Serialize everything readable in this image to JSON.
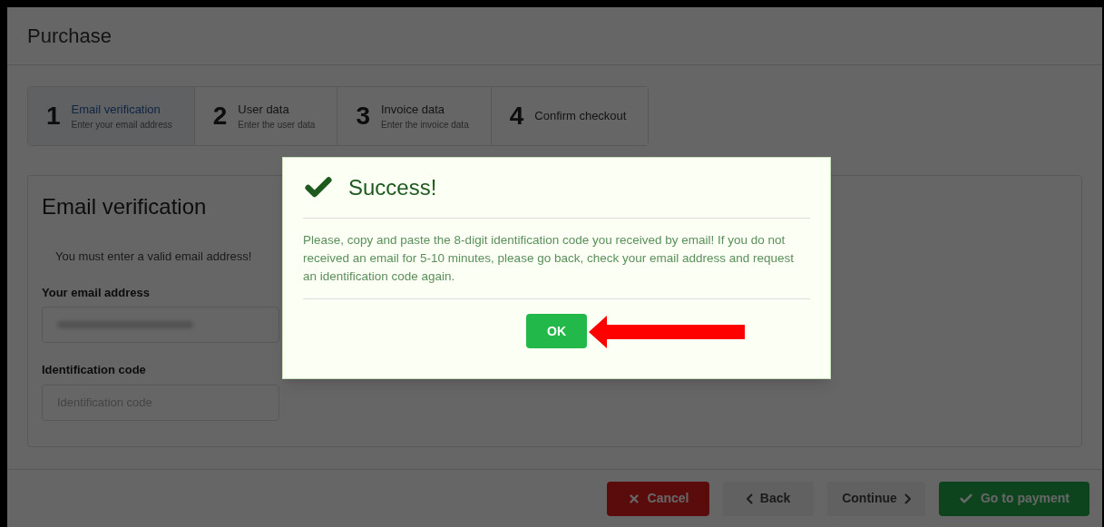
{
  "page": {
    "title": "Purchase"
  },
  "steps": [
    {
      "number": "1",
      "title": "Email verification",
      "subtitle": "Enter your email address",
      "selected": true
    },
    {
      "number": "2",
      "title": "User data",
      "subtitle": "Enter the user data",
      "selected": false
    },
    {
      "number": "3",
      "title": "Invoice data",
      "subtitle": "Enter the invoice data",
      "selected": false
    },
    {
      "number": "4",
      "title": "Confirm checkout",
      "selected": false
    }
  ],
  "form": {
    "heading": "Email verification",
    "notice": "You must enter a valid email address!",
    "fields": [
      {
        "label": "Your email address",
        "kind": "blurred"
      },
      {
        "label": "Identification code",
        "kind": "input",
        "placeholder": "Identification code"
      }
    ]
  },
  "footer_buttons": [
    {
      "label": "Cancel",
      "kind": "cancel",
      "disabled": false
    },
    {
      "label": "Back",
      "kind": "back",
      "disabled": true
    },
    {
      "label": "Continue",
      "kind": "continue",
      "disabled": true
    },
    {
      "label": "Go to payment",
      "kind": "pay",
      "disabled": false
    }
  ],
  "dialog": {
    "title": "Success!",
    "message": "Please, copy and paste the 8-digit identification code you received by email! If you do not received an email for 5-10 minutes, please go back, check your email address and request an identification code again.",
    "button": "OK"
  }
}
